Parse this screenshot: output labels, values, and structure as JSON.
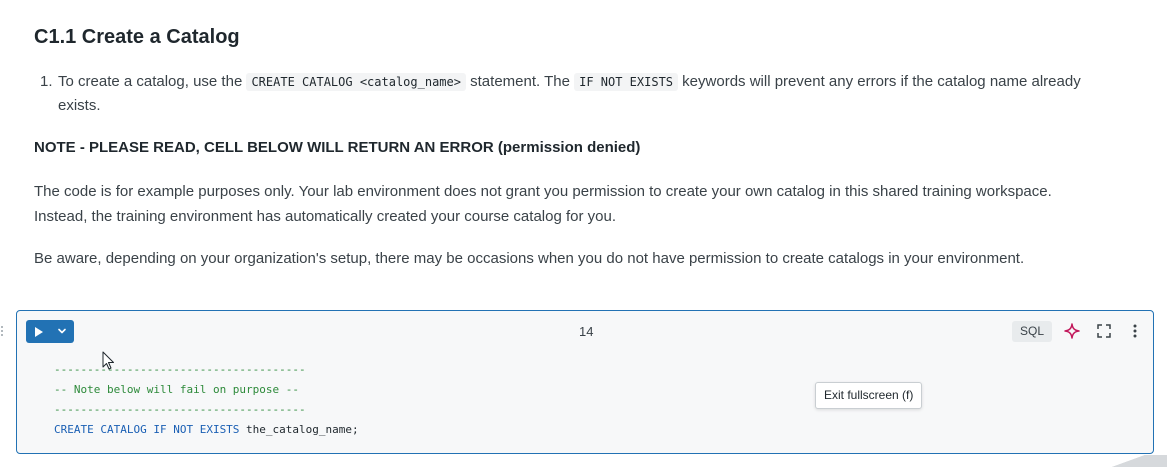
{
  "section": {
    "heading": "C1.1 Create a Catalog",
    "list_item": {
      "number": "1.",
      "text_before": "To create a catalog, use the ",
      "code1": "CREATE CATALOG <catalog_name>",
      "text_middle": " statement. The ",
      "code2": "IF NOT EXISTS",
      "text_after_line1": " keywords will prevent any errors if the catalog name already",
      "text_after_line2": "exists."
    },
    "note": "NOTE - PLEASE READ, CELL BELOW WILL RETURN AN ERROR (permission denied)",
    "paragraph1_line1": "The code is for example purposes only. Your lab environment does not grant you permission to create your own catalog in this shared training workspace.",
    "paragraph1_line2": "Instead, the training environment has automatically created your course catalog for you.",
    "paragraph2": "Be aware, depending on your organization's setup, there may be occasions when you do not have permission to create catalogs in your environment."
  },
  "cell": {
    "number": "14",
    "language": "SQL",
    "code_lines": {
      "line1": "--------------------------------------",
      "line2": "-- Note below will fail on purpose --",
      "line3": "--------------------------------------",
      "line4_keyword": "CREATE CATALOG IF NOT EXISTS",
      "line4_ident": " the_catalog_name;"
    },
    "tooltip": "Exit fullscreen (f)"
  },
  "icons": {
    "run": "play-icon",
    "run_menu": "chevron-down-icon",
    "assistant": "sparkle-icon",
    "fullscreen": "fullscreen-icon",
    "more": "kebab-menu-icon"
  },
  "colors": {
    "accent": "#2272b4",
    "comment": "#2d8a3a",
    "keyword": "#1a5fb4",
    "sparkle": "#c2185b"
  }
}
